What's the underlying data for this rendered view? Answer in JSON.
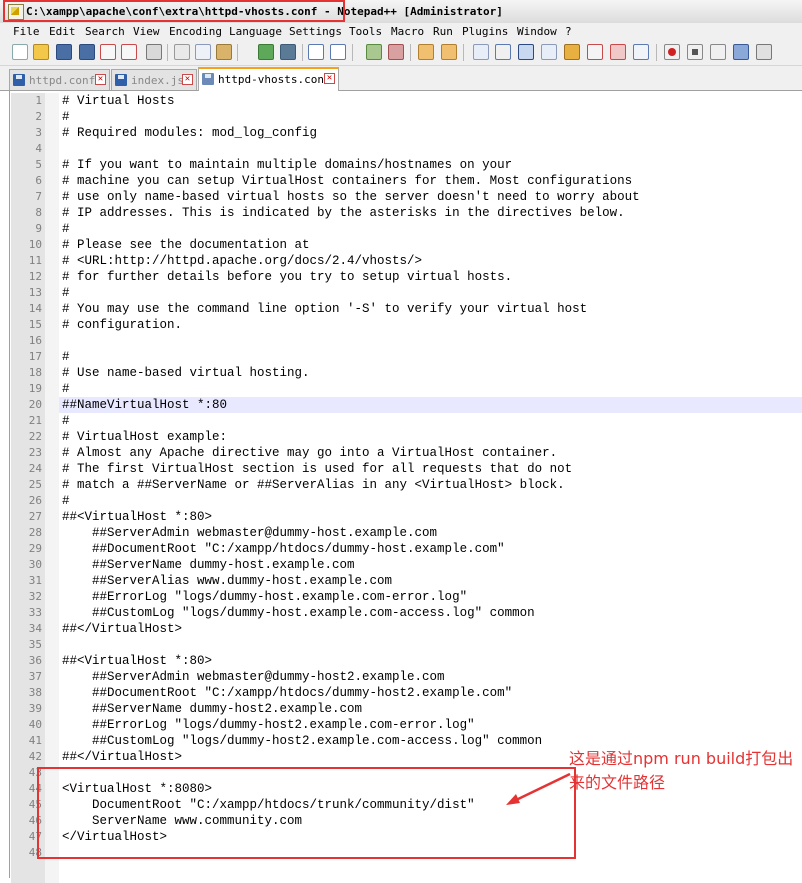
{
  "window": {
    "title": "C:\\xampp\\apache\\conf\\extra\\httpd-vhosts.conf - Notepad++ [Administrator]",
    "app_icon": "notepad-plus-plus-icon"
  },
  "menu": [
    "File",
    "Edit",
    "Search",
    "View",
    "Encoding",
    "Language",
    "Settings",
    "Tools",
    "Macro",
    "Run",
    "Plugins",
    "Window",
    "?"
  ],
  "toolbar": {
    "buttons": [
      "new-file-icon",
      "open-file-icon",
      "save-icon",
      "save-all-icon",
      "close-icon",
      "close-all-icon",
      "print-icon",
      "cut-icon",
      "copy-icon",
      "paste-icon",
      "undo-icon",
      "redo-icon",
      "find-icon",
      "replace-icon",
      "zoom-in-icon",
      "zoom-out-icon",
      "sync-vertical-icon",
      "sync-horizontal-icon",
      "word-wrap-icon",
      "show-all-chars-icon",
      "indent-guide-icon",
      "user-language-icon",
      "doc-map-icon",
      "function-list-icon",
      "folder-workspace-icon",
      "monitoring-icon",
      "record-macro-icon",
      "stop-record-icon",
      "play-macro-icon",
      "run-macro-multiple-icon",
      "save-macro-icon"
    ]
  },
  "tabs": [
    {
      "label": "httpd.conf",
      "active": false
    },
    {
      "label": "index.js",
      "active": false
    },
    {
      "label": "httpd-vhosts.conf",
      "active": true
    }
  ],
  "editor": {
    "current_line": 20,
    "lines": [
      "# Virtual Hosts",
      "#",
      "# Required modules: mod_log_config",
      "",
      "# If you want to maintain multiple domains/hostnames on your",
      "# machine you can setup VirtualHost containers for them. Most configurations",
      "# use only name-based virtual hosts so the server doesn't need to worry about",
      "# IP addresses. This is indicated by the asterisks in the directives below.",
      "#",
      "# Please see the documentation at",
      "# <URL:http://httpd.apache.org/docs/2.4/vhosts/>",
      "# for further details before you try to setup virtual hosts.",
      "#",
      "# You may use the command line option '-S' to verify your virtual host",
      "# configuration.",
      "",
      "#",
      "# Use name-based virtual hosting.",
      "#",
      "##NameVirtualHost *:80",
      "#",
      "# VirtualHost example:",
      "# Almost any Apache directive may go into a VirtualHost container.",
      "# The first VirtualHost section is used for all requests that do not",
      "# match a ##ServerName or ##ServerAlias in any <VirtualHost> block.",
      "#",
      "##<VirtualHost *:80>",
      "    ##ServerAdmin webmaster@dummy-host.example.com",
      "    ##DocumentRoot \"C:/xampp/htdocs/dummy-host.example.com\"",
      "    ##ServerName dummy-host.example.com",
      "    ##ServerAlias www.dummy-host.example.com",
      "    ##ErrorLog \"logs/dummy-host.example.com-error.log\"",
      "    ##CustomLog \"logs/dummy-host.example.com-access.log\" common",
      "##</VirtualHost>",
      "",
      "##<VirtualHost *:80>",
      "    ##ServerAdmin webmaster@dummy-host2.example.com",
      "    ##DocumentRoot \"C:/xampp/htdocs/dummy-host2.example.com\"",
      "    ##ServerName dummy-host2.example.com",
      "    ##ErrorLog \"logs/dummy-host2.example.com-error.log\"",
      "    ##CustomLog \"logs/dummy-host2.example.com-access.log\" common",
      "##</VirtualHost>",
      "",
      "<VirtualHost *:8080>",
      "    DocumentRoot \"C:/xampp/htdocs/trunk/community/dist\"",
      "    ServerName www.community.com",
      "</VirtualHost>",
      ""
    ]
  },
  "annotation": {
    "note": "这是通过npm run build打包出来的文件路径",
    "color": "#e53333"
  }
}
